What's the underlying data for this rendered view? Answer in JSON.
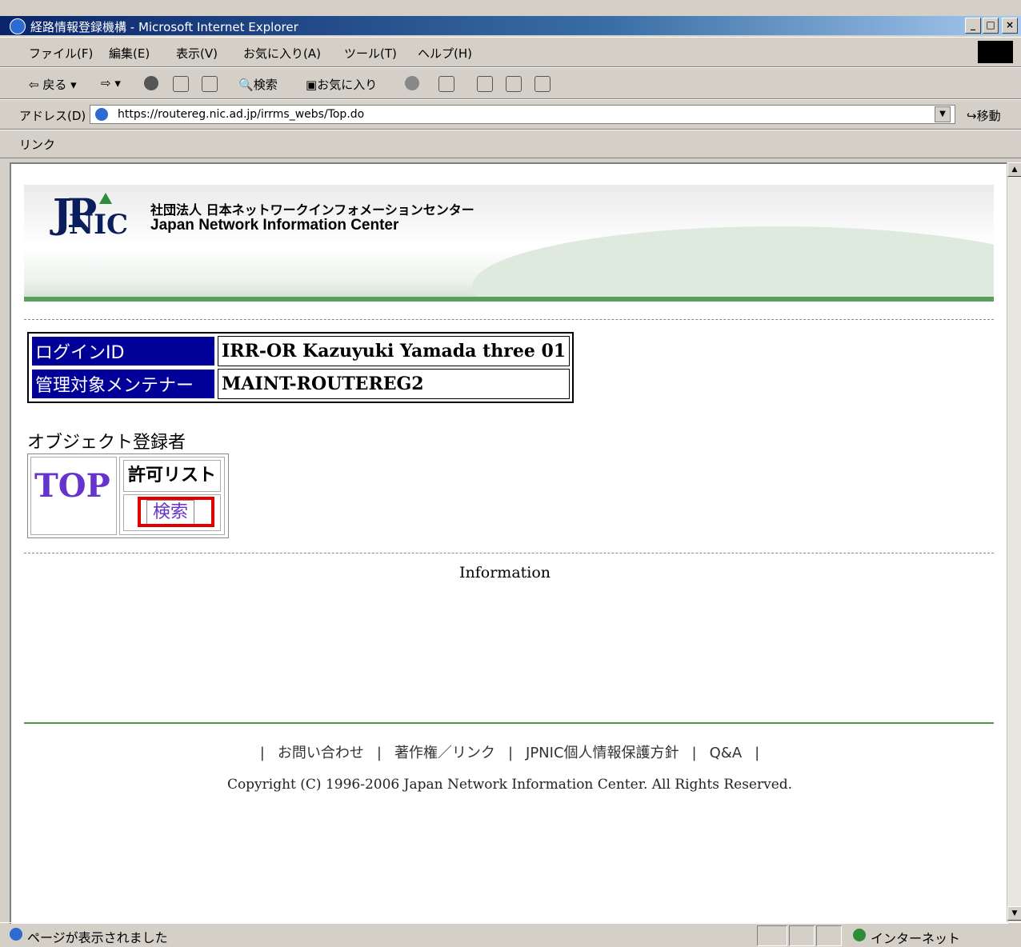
{
  "window": {
    "title": "経路情報登録機構 - Microsoft Internet Explorer",
    "controls": [
      "_",
      "□",
      "×"
    ]
  },
  "menu": [
    "ファイル(F)",
    "編集(E)",
    "表示(V)",
    "お気に入り(A)",
    "ツール(T)",
    "ヘルプ(H)"
  ],
  "toolbar": {
    "back": "戻る",
    "search": "検索",
    "favorites": "お気に入り"
  },
  "address": {
    "label": "アドレス(D)",
    "url": "https://routereg.nic.ad.jp/irrms_webs/Top.do",
    "go": "移動"
  },
  "links_label": "リンク",
  "header": {
    "logo_jp": "JP",
    "logo_nic": "NIC",
    "org_ja": "社団法人 日本ネットワークインフォメーションセンター",
    "org_en": "Japan Network Information Center"
  },
  "login": {
    "rows": [
      {
        "key": "ログインID",
        "value": "IRR-OR Kazuyuki Yamada three 01"
      },
      {
        "key": "管理対象メンテナー",
        "value": "MAINT-ROUTEREG2"
      }
    ]
  },
  "section_title": "オブジェクト登録者",
  "nav": {
    "top": "TOP",
    "list_header": "許可リスト",
    "search": "検索"
  },
  "information": "Information",
  "footer": {
    "links": [
      "お問い合わせ",
      "著作権／リンク",
      "JPNIC個人情報保護方針",
      "Q&A"
    ],
    "copyright": "Copyright (C) 1996-2006 Japan Network Information Center. All Rights Reserved."
  },
  "status": {
    "message": "ページが表示されました",
    "zone": "インターネット"
  }
}
